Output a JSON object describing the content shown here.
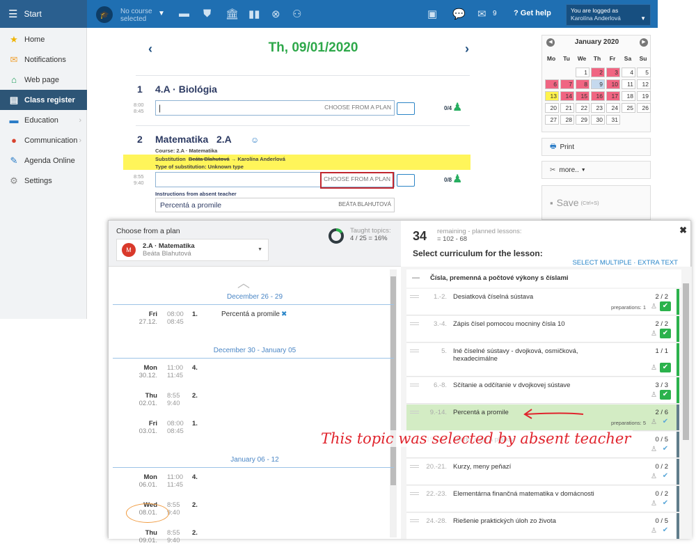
{
  "topbar": {
    "start_label": "Start",
    "course_line1": "No course",
    "course_line2": "selected",
    "mail_count": "9",
    "help_label": "Get help",
    "logged_as": "You are logged as",
    "user_name": "Karolína Anderlová"
  },
  "sidebar": {
    "items": [
      {
        "label": "Home",
        "icon": "star-icon"
      },
      {
        "label": "Notifications",
        "icon": "envelope-icon"
      },
      {
        "label": "Web page",
        "icon": "house-icon"
      },
      {
        "label": "Class register",
        "icon": "register-icon"
      },
      {
        "label": "Education",
        "icon": "briefcase-icon"
      },
      {
        "label": "Communication",
        "icon": "people-icon"
      },
      {
        "label": "Agenda Online",
        "icon": "pen-icon"
      },
      {
        "label": "Settings",
        "icon": "gear-icon"
      }
    ]
  },
  "main": {
    "date": "Th, 09/01/2020",
    "lesson1": {
      "number": "1",
      "title": "4.A · Biológia",
      "time_start": "8:00",
      "time_end": "8:45",
      "choose_label": "CHOOSE FROM A PLAN",
      "count": "0/4"
    },
    "lesson2": {
      "number": "2",
      "title": "Matematika",
      "class": "2.A",
      "course": "Course:  2.A · Matematika",
      "subst_label": "Substitution",
      "subst_from": "Beáta Blahutová",
      "subst_to": "→ Karolína Anderlová",
      "subst_type": "Type of substitution:  Unknown type",
      "time_start": "8:55",
      "time_end": "9:40",
      "choose_label": "CHOOSE FROM A PLAN",
      "count": "0/8",
      "instructions_label": "Instructions from absent teacher",
      "instruction_text": "Percentá a promile",
      "instruction_teacher": "BEÁTA BLAHUTOVÁ"
    }
  },
  "calendar": {
    "month": "January 2020",
    "dow": [
      "Mo",
      "Tu",
      "We",
      "Th",
      "Fr",
      "Sa",
      "Su"
    ],
    "weeks": [
      [
        {
          "d": "",
          "c": ""
        },
        {
          "d": "",
          "c": ""
        },
        {
          "d": "1",
          "c": ""
        },
        {
          "d": "2",
          "c": "red"
        },
        {
          "d": "3",
          "c": "red"
        },
        {
          "d": "4",
          "c": ""
        },
        {
          "d": "5",
          "c": ""
        }
      ],
      [
        {
          "d": "6",
          "c": "red"
        },
        {
          "d": "7",
          "c": "red"
        },
        {
          "d": "8",
          "c": "red"
        },
        {
          "d": "9",
          "c": "blue"
        },
        {
          "d": "10",
          "c": "red"
        },
        {
          "d": "11",
          "c": ""
        },
        {
          "d": "12",
          "c": ""
        }
      ],
      [
        {
          "d": "13",
          "c": "yellow"
        },
        {
          "d": "14",
          "c": "red"
        },
        {
          "d": "15",
          "c": "red"
        },
        {
          "d": "16",
          "c": "red"
        },
        {
          "d": "17",
          "c": "red"
        },
        {
          "d": "18",
          "c": ""
        },
        {
          "d": "19",
          "c": ""
        }
      ],
      [
        {
          "d": "20",
          "c": ""
        },
        {
          "d": "21",
          "c": ""
        },
        {
          "d": "22",
          "c": ""
        },
        {
          "d": "23",
          "c": ""
        },
        {
          "d": "24",
          "c": ""
        },
        {
          "d": "25",
          "c": ""
        },
        {
          "d": "26",
          "c": ""
        }
      ],
      [
        {
          "d": "27",
          "c": ""
        },
        {
          "d": "28",
          "c": ""
        },
        {
          "d": "29",
          "c": ""
        },
        {
          "d": "30",
          "c": ""
        },
        {
          "d": "31",
          "c": ""
        },
        {
          "d": "",
          "c": "none"
        },
        {
          "d": "",
          "c": "none"
        }
      ]
    ]
  },
  "actions": {
    "print": "Print",
    "more": "more..",
    "save": "Save",
    "save_hint": "(Ctrl+S)"
  },
  "plan_panel": {
    "title": "Choose from a plan",
    "avatar_letter": "M",
    "course": "2.A · Matematika",
    "teacher": "Beáta Blahutová",
    "taught_label": "Taught topics:",
    "taught_value": "4 / 25 = 16%",
    "taught_fraction": 0.16,
    "groups": [
      {
        "range": "December 26 - 29",
        "rows": [
          {
            "day": "Fri",
            "date": "27.12.",
            "t1": "08:00",
            "t2": "08:45",
            "n": "1.",
            "topic": "Percentá a promile"
          }
        ]
      },
      {
        "range": "December 30 - January 05",
        "rows": [
          {
            "day": "Mon",
            "date": "30.12.",
            "t1": "11:00",
            "t2": "11:45",
            "n": "4.",
            "topic": ""
          },
          {
            "day": "Thu",
            "date": "02.01.",
            "t1": "8:55",
            "t2": "9:40",
            "n": "2.",
            "topic": ""
          },
          {
            "day": "Fri",
            "date": "03.01.",
            "t1": "08:00",
            "t2": "08:45",
            "n": "1.",
            "topic": ""
          }
        ]
      },
      {
        "range": "January 06 - 12",
        "rows": [
          {
            "day": "Mon",
            "date": "06.01.",
            "t1": "11:00",
            "t2": "11:45",
            "n": "4.",
            "topic": ""
          },
          {
            "day": "Wed",
            "date": "08.01.",
            "t1": "8:55",
            "t2": "9:40",
            "n": "2.",
            "topic": ""
          },
          {
            "day": "Thu",
            "date": "09.01.",
            "t1": "8:55",
            "t2": "9:40",
            "n": "2.",
            "topic": ""
          }
        ]
      }
    ]
  },
  "curriculum": {
    "remaining_count": "34",
    "remaining_label": "remaining - planned lessons:",
    "remaining_formula": "= 102 - 68",
    "heading": "Select curriculum for the lesson:",
    "select_multiple": "SELECT MULTIPLE",
    "extra_text": "EXTRA TEXT",
    "section": "Čísla, premenná a počtové výkony s číslami",
    "rows": [
      {
        "range": "1.-2.",
        "name": "Desiatková číselná sústava",
        "ratio": "2 / 2",
        "prep": "preparations: 1",
        "done": true,
        "hl": false
      },
      {
        "range": "3.-4.",
        "name": "Zápis čísel pomocou mocniny čísla 10",
        "ratio": "2 / 2",
        "prep": "",
        "done": true,
        "hl": false
      },
      {
        "range": "5.",
        "name": "Iné číselné sústavy - dvojková, osmičková, hexadecimálne",
        "ratio": "1 / 1",
        "prep": "",
        "done": true,
        "hl": false
      },
      {
        "range": "6.-8.",
        "name": "Sčítanie a odčítanie v dvojkovej sústave",
        "ratio": "3 / 3",
        "prep": "",
        "done": true,
        "hl": false
      },
      {
        "range": "9.-14.",
        "name": "Percentá a promile",
        "ratio": "2 / 6",
        "prep": "preparations: 5",
        "done": false,
        "hl": true
      },
      {
        "range": "15.-19.",
        "name": "Mierky máp a plánov",
        "ratio": "0 / 5",
        "prep": "",
        "done": false,
        "hl": false
      },
      {
        "range": "20.-21.",
        "name": "Kurzy, meny peňazí",
        "ratio": "0 / 2",
        "prep": "",
        "done": false,
        "hl": false
      },
      {
        "range": "22.-23.",
        "name": "Elementárna finančná matematika v domácnosti",
        "ratio": "0 / 2",
        "prep": "",
        "done": false,
        "hl": false
      },
      {
        "range": "24.-28.",
        "name": "Riešenie praktických úloh zo života",
        "ratio": "0 / 5",
        "prep": "",
        "done": false,
        "hl": false
      }
    ]
  },
  "annotation": {
    "text": "This topic was selected by absent teacher",
    "color": "#e0242d"
  }
}
